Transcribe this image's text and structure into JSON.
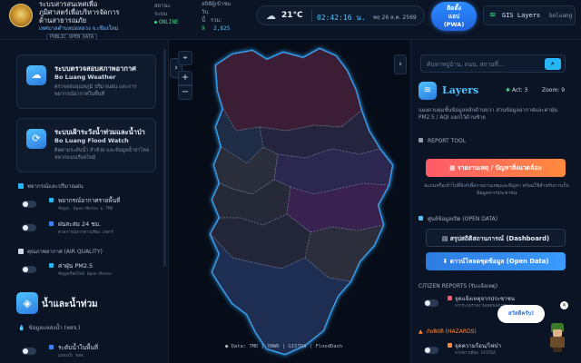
{
  "header": {
    "org_line1": "ระบบสารสนเทศเพื่อ",
    "org_line2": "ภูมิศาสตร์เพื่อบริหารจัดการ",
    "org_line3": "ด้านสาธารณภัย",
    "org_line4": "เทศบาลตำบลบ่อหลวง จ.เชียงใหม่",
    "org_chip": "PUBLIC OPEN DATA",
    "system_label_1": "สถานะ",
    "system_label_2": "ระบบ",
    "online": "ONLINE",
    "stat_label": "สถิติผู้เข้าชม",
    "stat_today_label": "วัน",
    "stat_today": "9",
    "stat_total_label": "รวม:",
    "stat_total": "2,825",
    "stat_row3": "นี้",
    "weather_icon": "cloud-icon",
    "temp": "21°C",
    "time": "02:42:16 น.",
    "date": "พฤ 26 ส.ค. 2569",
    "pwa_line1": "ติดตั้ง",
    "pwa_line2": "แอป",
    "pwa_line3": "(PWA)",
    "gis_label": "GIS Layers",
    "user": "boluang"
  },
  "left_panel": {
    "cards": [
      {
        "icon": "cloud-icon",
        "title_th": "ระบบตรวจสอบสภาพอากาศ",
        "title_en": "Bo Luang Weather",
        "desc": "ตรวจสอบอุณหภูมิ ปริมาณฝน และการพยากรณ์อากาศในพื้นที่"
      },
      {
        "icon": "refresh-icon",
        "title_th": "ระบบเฝ้าระวังน้ำท่วมและน้ำป่า",
        "title_en": "Bo Luang Flood Watch",
        "desc": "ติดตามระดับน้ำ ลำห้วย และข้อมูลน้ำป่าไหลหลากแบบเรียลไทม์"
      }
    ],
    "sections": {
      "weather_rain": "พยากรณ์และปริมาณฝน",
      "air_quality": "คุณภาพอากาศ (AIR QUALITY)",
      "water_title": "น้ำและน้ำท่วม",
      "water_sub": "ข้อมูลแหล่งน้ำ (ทสจ.)"
    },
    "layers": [
      {
        "name": "พยากรณ์อากาศรายพื้นที่",
        "source": "ข้อมูล: Open-Meteo & TMD",
        "color": "#29b6f6",
        "on": false
      },
      {
        "name": "ฝนสะสม 24 ชม.",
        "source": "คาดการณ์จากดาวเทียม เรดาร์",
        "color": "#3b82f6",
        "on": false
      },
      {
        "name": "ค่าฝุ่น PM2.5",
        "source": "ข้อมูลเรียลไทม์ Open-Meteo",
        "color": "#29b6f6",
        "on": false
      },
      {
        "name": "ระดับน้ำในพื้นที่",
        "source": "แหล่งน้ำ ทสจ.",
        "color": "#3b82f6",
        "on": false
      }
    ]
  },
  "map": {
    "attribution": "Data: TMD | ONWR | GISTDA | FloodDash"
  },
  "right_panel": {
    "search_placeholder": "ค้นหาหมู่บ้าน, ถนน, สถานที่...",
    "layers_title": "Layers",
    "active_label": "Act:",
    "active_count": "3",
    "zoom_label": "Zoom:",
    "zoom_value": "9",
    "layers_desc": "แผงควบคุมชั้นข้อมูลหลักด้านขวา ส่วนข้อมูลอากาศและค่าฝุ่น PM2.5 / AQI แยกไว้ด้านซ้าย",
    "report_tool": "REPORT TOOL",
    "report_btn": "รายงานเหตุ / ปัญหาสิ่งแวดล้อม",
    "report_note": "สแกนหรือเข้าไปที่ลิงก์เพื่อรายงานเหตุและปัญหา พร้อมใช้สำหรับการเก็บข้อมูลจากประชาชน",
    "open_data_section": "ศูนย์ข้อมูลเปิด (OPEN DATA)",
    "dash_btn": "สรุปสถิติสถานการณ์ (Dashboard)",
    "open_btn": "ดาวน์โหลดชุดข้อมูล (Open Data)",
    "citizen_section": "CITIZEN REPORTS (รับแจ้งเหตุ)",
    "citizen_item": "จุดแจ้งเหตุจากประชาชน",
    "citizen_source": "จากระบบรายงานเหตุของเทศบาล",
    "hazard_section": "ภัยพิบัติ (HAZARDS)",
    "hazard_item": "จุดความร้อน/ไฟป่า",
    "hazard_source": "จากดาวเทียม GISTDA",
    "help_text": "สวัสดีครับ!",
    "colors": {
      "accent": "#4fc3ff",
      "report": "#ff5a6a",
      "open": "#2d7be0"
    }
  }
}
